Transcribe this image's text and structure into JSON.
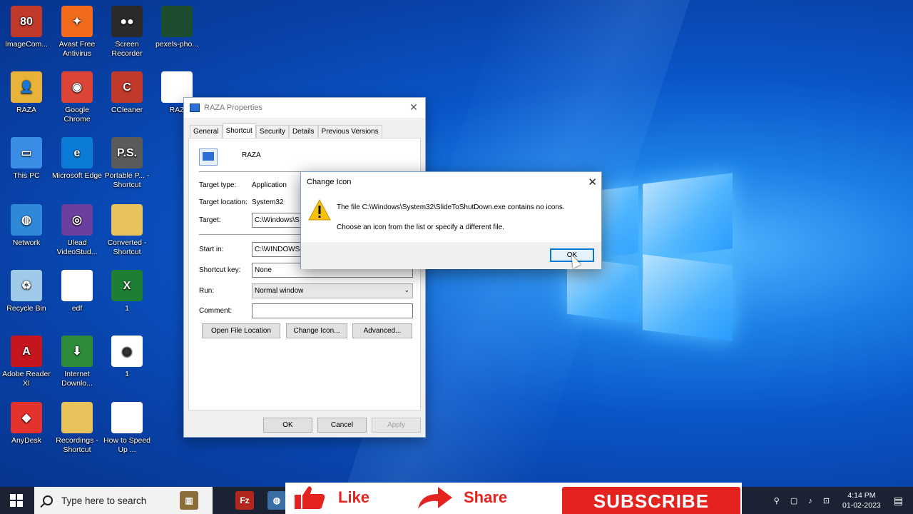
{
  "desktop": {
    "icons": [
      {
        "label": "ImageCom...",
        "color": "#c0392b",
        "glyph": "80"
      },
      {
        "label": "Avast Free Antivirus",
        "color": "#f26b1d",
        "glyph": "✦"
      },
      {
        "label": "Screen Recorder",
        "color": "#2a2a2a",
        "glyph": "●●"
      },
      {
        "label": "pexels-pho...",
        "color": "#1b4d2e",
        "glyph": ""
      },
      {
        "label": "RAZA",
        "color": "#e8b339",
        "glyph": "👤"
      },
      {
        "label": "Google Chrome",
        "color": "#db4437",
        "glyph": "◉"
      },
      {
        "label": "CCleaner",
        "color": "#c0392b",
        "glyph": "C"
      },
      {
        "label": "RAZ",
        "color": "#ffffff",
        "glyph": ""
      },
      {
        "label": "This PC",
        "color": "#3a8ee6",
        "glyph": "▭"
      },
      {
        "label": "Microsoft Edge",
        "color": "#0c7bd6",
        "glyph": "e"
      },
      {
        "label": "Portable P... - Shortcut",
        "color": "#5a5a5a",
        "glyph": "P.S."
      },
      {
        "label": "Network",
        "color": "#2f89d9",
        "glyph": "◍"
      },
      {
        "label": "Ulead VideoStud...",
        "color": "#6b3fa0",
        "glyph": "◎"
      },
      {
        "label": "Converted - Shortcut",
        "color": "#e8c25a",
        "glyph": ""
      },
      {
        "label": "Recycle Bin",
        "color": "#9ec9e8",
        "glyph": "♻"
      },
      {
        "label": "edf",
        "color": "#ffffff",
        "glyph": ""
      },
      {
        "label": "1",
        "color": "#1e7e34",
        "glyph": "X"
      },
      {
        "label": "Adobe Reader XI",
        "color": "#c4161c",
        "glyph": "A"
      },
      {
        "label": "Internet Downlo...",
        "color": "#2e8b3a",
        "glyph": "⬇"
      },
      {
        "label": "1",
        "color": "#ffffff",
        "glyph": "◉"
      },
      {
        "label": "AnyDesk",
        "color": "#e5322d",
        "glyph": "◆"
      },
      {
        "label": "Recordings - Shortcut",
        "color": "#e8c25a",
        "glyph": ""
      },
      {
        "label": "How to Speed Up ...",
        "color": "#ffffff",
        "glyph": ""
      }
    ]
  },
  "props_dialog": {
    "title": "RAZA Properties",
    "tabs": [
      "General",
      "Shortcut",
      "Security",
      "Details",
      "Previous Versions"
    ],
    "name": "RAZA",
    "target_type_label": "Target type:",
    "target_type": "Application",
    "target_location_label": "Target location:",
    "target_location": "System32",
    "target_label": "Target:",
    "target": "C:\\Windows\\S",
    "start_in_label": "Start in:",
    "start_in": "C:\\WINDOWS",
    "shortcut_key_label": "Shortcut key:",
    "shortcut_key": "None",
    "run_label": "Run:",
    "run": "Normal window",
    "comment_label": "Comment:",
    "comment": "",
    "open_location": "Open File Location",
    "change_icon": "Change Icon...",
    "advanced": "Advanced...",
    "ok": "OK",
    "cancel": "Cancel",
    "apply": "Apply"
  },
  "change_icon_dialog": {
    "title": "Change Icon",
    "message1": "The file C:\\Windows\\System32\\SlideToShutDown.exe contains no icons.",
    "message2": "Choose an icon from the list or specify a different file.",
    "ok": "OK"
  },
  "taskbar": {
    "search_placeholder": "Type here to search",
    "time": "4:14 PM",
    "date": "01-02-2023"
  },
  "banner": {
    "like": "Like",
    "share": "Share",
    "subscribe": "SUBSCRIBE"
  }
}
